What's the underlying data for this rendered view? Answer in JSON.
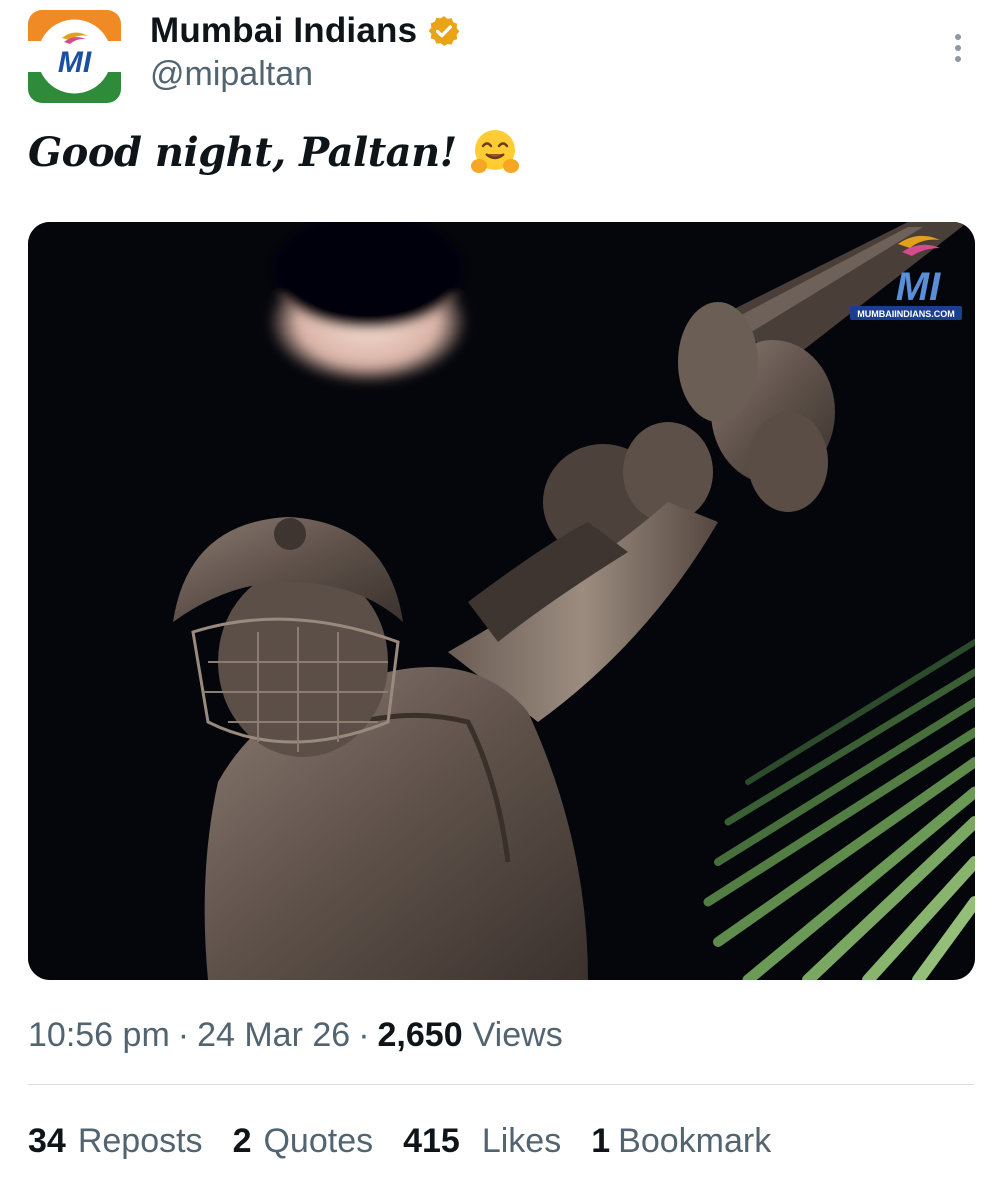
{
  "author": {
    "display_name": "Mumbai Indians",
    "handle": "@mipaltan",
    "avatar_text": "MI",
    "verified_icon": "verified-badge-icon",
    "verified_color": "#e8a317"
  },
  "post": {
    "text": "Good night, Paltan!",
    "emoji": "🤗",
    "media_watermark": "MUMBAIINDIANS.COM",
    "media_logo_text": "MI"
  },
  "meta": {
    "time": "10:56 pm",
    "date": "24 Mar 26",
    "views_count": "2,650",
    "views_label": "Views",
    "separator": "·"
  },
  "stats": [
    {
      "count": "34",
      "label": "Reposts"
    },
    {
      "count": "2",
      "label": "Quotes"
    },
    {
      "count": "415",
      "label": "Likes"
    },
    {
      "count": "1",
      "label": "Bookmark"
    }
  ],
  "colors": {
    "text_primary": "#0f1419",
    "text_secondary": "#536471",
    "divider": "#d9dde1",
    "brand_blue": "#1b4fa0",
    "brand_saffron": "#f08a24",
    "brand_green": "#2e8b3a"
  }
}
